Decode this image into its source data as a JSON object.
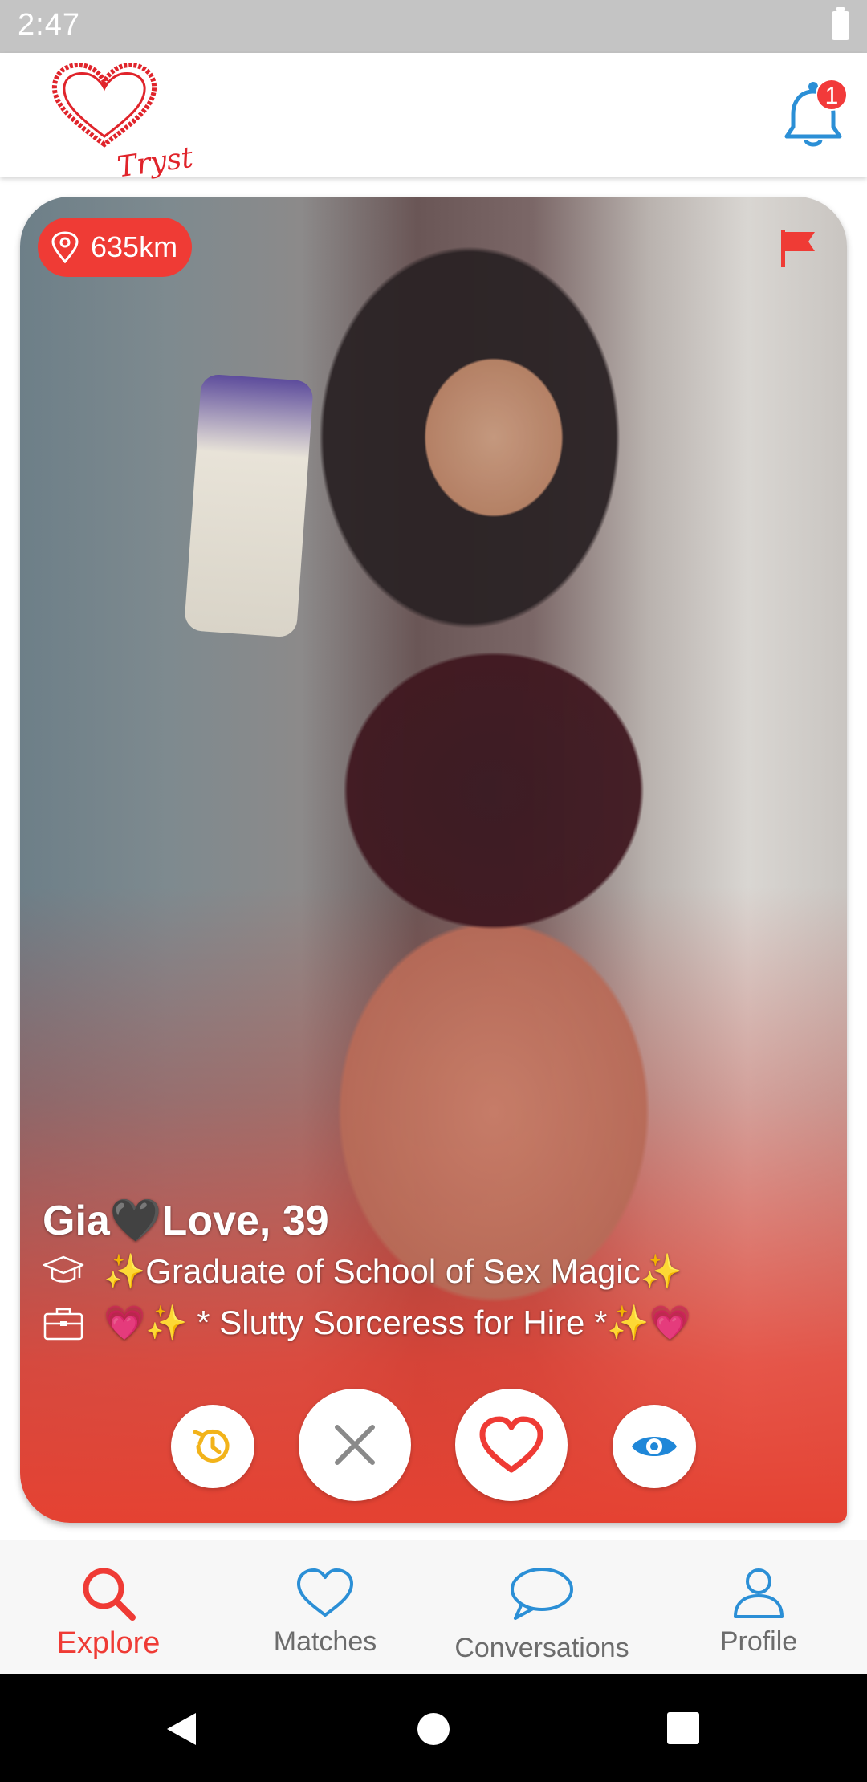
{
  "status_bar": {
    "time": "2:47",
    "battery_icon": "battery-full-icon"
  },
  "header": {
    "logo_text": "Tryst",
    "notification_count": "1",
    "logo_icon": "heart-logo-icon",
    "bell_icon": "bell-icon"
  },
  "profile": {
    "distance": "635km",
    "name_line": "Gia🖤Love, 39",
    "education": "✨Graduate of School of Sex Magic✨",
    "occupation": "💗✨ * Slutty Sorceress for Hire *✨💗"
  },
  "actions": [
    {
      "id": "rewind",
      "icon": "rewind-icon"
    },
    {
      "id": "pass",
      "icon": "close-icon"
    },
    {
      "id": "like",
      "icon": "heart-icon"
    },
    {
      "id": "view",
      "icon": "eye-icon"
    }
  ],
  "bottom_nav": {
    "explore": "Explore",
    "matches": "Matches",
    "conversations": "Conversations",
    "profile": "Profile"
  },
  "colors": {
    "accent": "#ef3b35",
    "nav_blue": "#2b8fd6",
    "rewind_yellow": "#f2b31a",
    "view_blue": "#1f87d8",
    "pass_gray": "#8a8a8a"
  }
}
